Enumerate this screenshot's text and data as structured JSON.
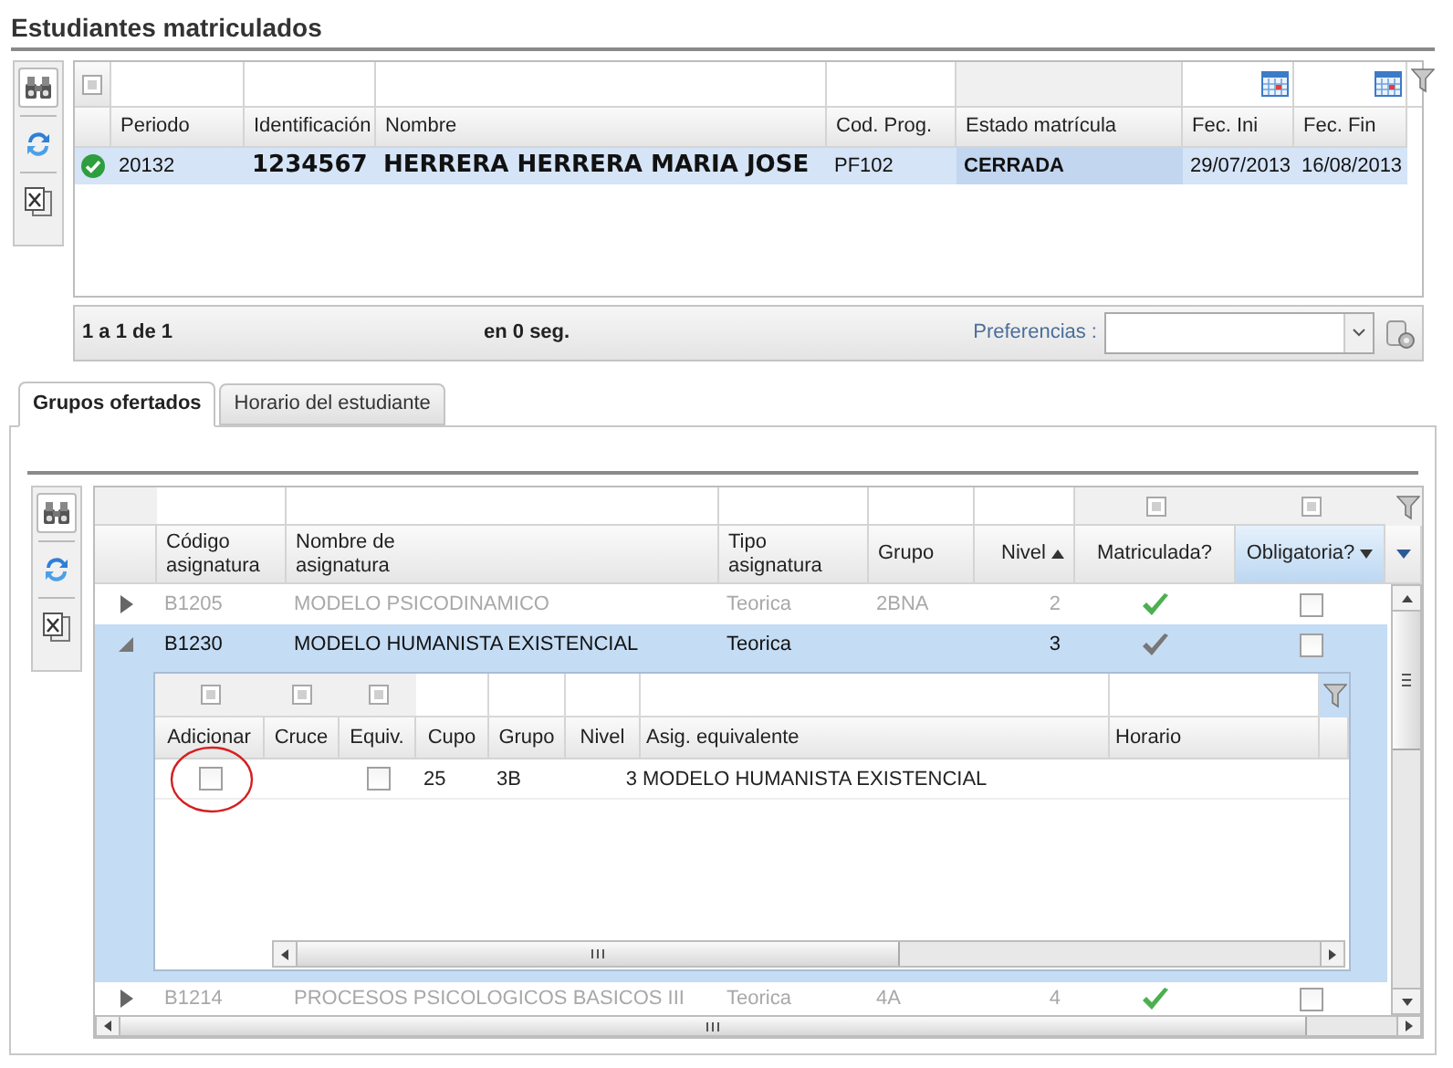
{
  "section_title": "Estudiantes matriculados",
  "students_grid": {
    "select_all_indeterminate": true,
    "columns": [
      {
        "label": "Periodo",
        "kind": "plain",
        "bold": false,
        "large": false,
        "highlighted": false
      },
      {
        "label": "Identificación",
        "kind": "plain",
        "bold": true,
        "large": true,
        "highlighted": false
      },
      {
        "label": "Nombre",
        "kind": "plain",
        "bold": true,
        "large": true,
        "highlighted": false
      },
      {
        "label": "Cod. Prog.",
        "kind": "plain",
        "bold": false,
        "large": false,
        "highlighted": false
      },
      {
        "label": "Estado matrícula",
        "kind": "select",
        "bold": true,
        "large": false,
        "highlighted": true
      },
      {
        "label": "Fec. Ini",
        "kind": "date",
        "bold": false,
        "large": false,
        "highlighted": false
      },
      {
        "label": "Fec. Fin",
        "kind": "date",
        "bold": false,
        "large": false,
        "highlighted": false
      }
    ],
    "rows": [
      {
        "check_icon": true,
        "selected": true,
        "cells": [
          "20132",
          "1234567",
          "HERRERA HERRERA MARIA JOSE",
          "PF102",
          "CERRADA",
          "29/07/2013",
          "16/08/2013"
        ]
      }
    ],
    "footer": {
      "range": "1 a 1 de 1",
      "time": "en 0 seg.",
      "preferences_label": "Preferencias :"
    }
  },
  "tabs": [
    {
      "label": "Grupos ofertados",
      "selected": true
    },
    {
      "label": "Horario del estudiante",
      "selected": false
    }
  ],
  "groups_grid": {
    "columns": [
      {
        "label": "Código asignatura",
        "kind": "plain",
        "sort_ascending": false,
        "sort_descending": false,
        "active": false
      },
      {
        "label": "Nombre de asignatura",
        "kind": "plain",
        "sort_ascending": false,
        "sort_descending": false,
        "active": false
      },
      {
        "label": "Tipo asignatura",
        "kind": "plain",
        "sort_ascending": false,
        "sort_descending": false,
        "active": false
      },
      {
        "label": "Grupo",
        "kind": "plain",
        "sort_ascending": false,
        "sort_descending": false,
        "active": false
      },
      {
        "label": "Nivel",
        "kind": "plain",
        "sort_ascending": true,
        "sort_descending": false,
        "active": false
      },
      {
        "label": "Matriculada?",
        "kind": "checkbox",
        "filter_indeterminate": true,
        "sort_ascending": false,
        "sort_descending": false,
        "active": false
      },
      {
        "label": "Obligatoria?",
        "kind": "checkbox",
        "filter_indeterminate": true,
        "sort_ascending": false,
        "sort_descending": true,
        "active": true
      }
    ],
    "rows": [
      {
        "expanded": false,
        "selected": false,
        "disabled": true,
        "code": "B1205",
        "name": "MODELO PSICODINAMICO",
        "type": "Teorica",
        "group": "2BNA",
        "level": "2",
        "color": "#4caf50",
        "obligatoria_checked": false
      },
      {
        "expanded": true,
        "selected": true,
        "disabled": false,
        "code": "B1230",
        "name": "MODELO HUMANISTA EXISTENCIAL",
        "type": "Teorica",
        "level": "3",
        "color": "#777777",
        "obligatoria_checked": false,
        "detail": {
          "columns": [
            {
              "label": "Adicionar",
              "kind": "checkbox",
              "filter_indeterminate": true
            },
            {
              "label": "Cruce",
              "kind": "checkbox",
              "filter_indeterminate": true
            },
            {
              "label": "Equiv.",
              "kind": "checkbox",
              "filter_indeterminate": true
            },
            {
              "label": "Cupo",
              "kind": "plain"
            },
            {
              "label": "Grupo",
              "kind": "plain"
            },
            {
              "label": "Nivel",
              "kind": "plain"
            },
            {
              "label": "Asig. equivalente",
              "kind": "plain"
            },
            {
              "label": "Horario",
              "kind": "plain"
            }
          ],
          "rows": [
            {
              "adicionar_checked": false,
              "adicionar_circled": true,
              "equiv_checked": false,
              "cupo": "25",
              "grupo": "3B",
              "nivel": "3",
              "asig": "MODELO HUMANISTA EXISTENCIAL"
            }
          ]
        }
      },
      {
        "expanded": false,
        "selected": false,
        "disabled": true,
        "code": "B1214",
        "name": "PROCESOS PSICOLOGICOS BASICOS III",
        "type": "Teorica",
        "group": "4A",
        "level": "4",
        "color": "#4caf50",
        "obligatoria_checked": false
      }
    ]
  }
}
